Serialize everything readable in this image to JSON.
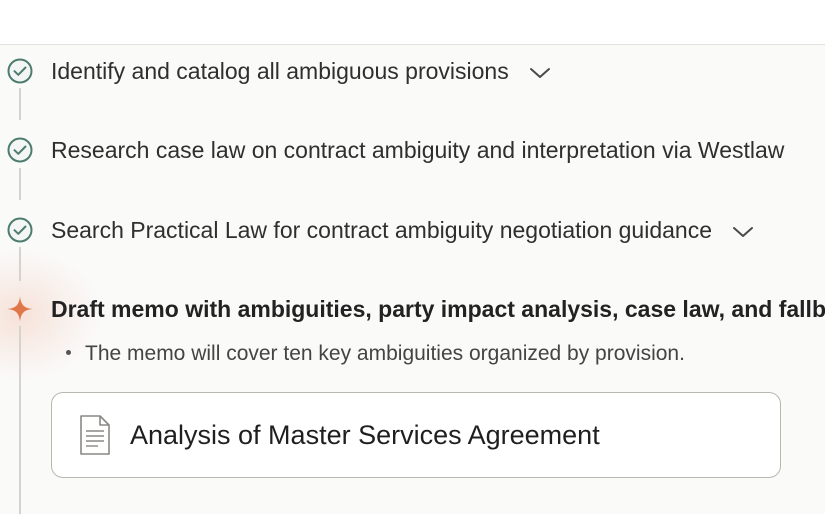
{
  "steps": [
    {
      "label": "Identify and catalog all ambiguous provisions",
      "status": "complete",
      "expandable": true
    },
    {
      "label": "Research case law on contract ambiguity and interpretation via Westlaw",
      "status": "complete",
      "expandable": false
    },
    {
      "label": "Search Practical Law for contract ambiguity negotiation guidance",
      "status": "complete",
      "expandable": true
    },
    {
      "label": "Draft memo with ambiguities, party impact analysis, case law, and fallb",
      "status": "in-progress",
      "expandable": false
    }
  ],
  "active_step_detail": {
    "bullet": "The memo will cover ten key ambiguities organized by provision."
  },
  "document_card": {
    "title": "Analysis of Master Services Agreement",
    "icon": "document-icon"
  },
  "colors": {
    "check": "#4d7c6f",
    "active_star": "#e0774a",
    "timeline": "#d6d3ce"
  }
}
